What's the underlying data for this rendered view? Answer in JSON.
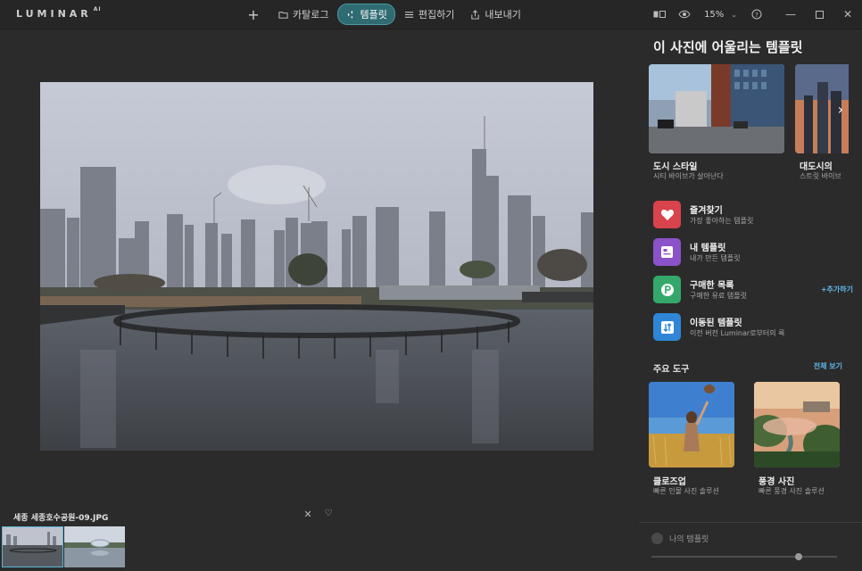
{
  "app": {
    "logo": "LUMINAR",
    "logo_suffix": "AI"
  },
  "nav": {
    "tabs": [
      {
        "label": "카탈로그",
        "icon": "folder-icon"
      },
      {
        "label": "템플릿",
        "icon": "sparkle-icon",
        "active": true
      },
      {
        "label": "편집하기",
        "icon": "sliders-icon"
      },
      {
        "label": "내보내기",
        "icon": "share-icon"
      }
    ]
  },
  "toolbar": {
    "zoom": "15%"
  },
  "viewer": {
    "filename": "세종 세종호수공원-09.JPG"
  },
  "panel": {
    "title": "이 사진에 어울리는 템플릿",
    "cards": [
      {
        "title": "도시 스타일",
        "subtitle": "시티 바이브가 살아난다"
      },
      {
        "title": "대도시의 ",
        "subtitle": "스트릿 바이브"
      }
    ],
    "list": [
      {
        "title": "즐겨찾기",
        "subtitle": "가장 좋아하는 템플릿",
        "color": "#d9434b"
      },
      {
        "title": "내 템플릿",
        "subtitle": "내가 만든 템플릿",
        "color": "#8b52c9"
      },
      {
        "title": "구매한 목록",
        "subtitle": "구매한 유료 템플릿",
        "color": "#33a86a",
        "action": "+추가하기"
      },
      {
        "title": "이동된 템플릿",
        "subtitle": "이전 버전 Luminar로부터의 룩",
        "color": "#2f86d6"
      }
    ],
    "tools_header": "주요 도구",
    "tools_link": "전체 보기",
    "tools": [
      {
        "title": "클로즈업",
        "subtitle": "빠른 인물 사진 솔루션"
      },
      {
        "title": "풍경 사진",
        "subtitle": "빠른 풍경 사진 솔루션"
      }
    ],
    "faded_label": "",
    "my_templates": "나의 템플릿"
  }
}
